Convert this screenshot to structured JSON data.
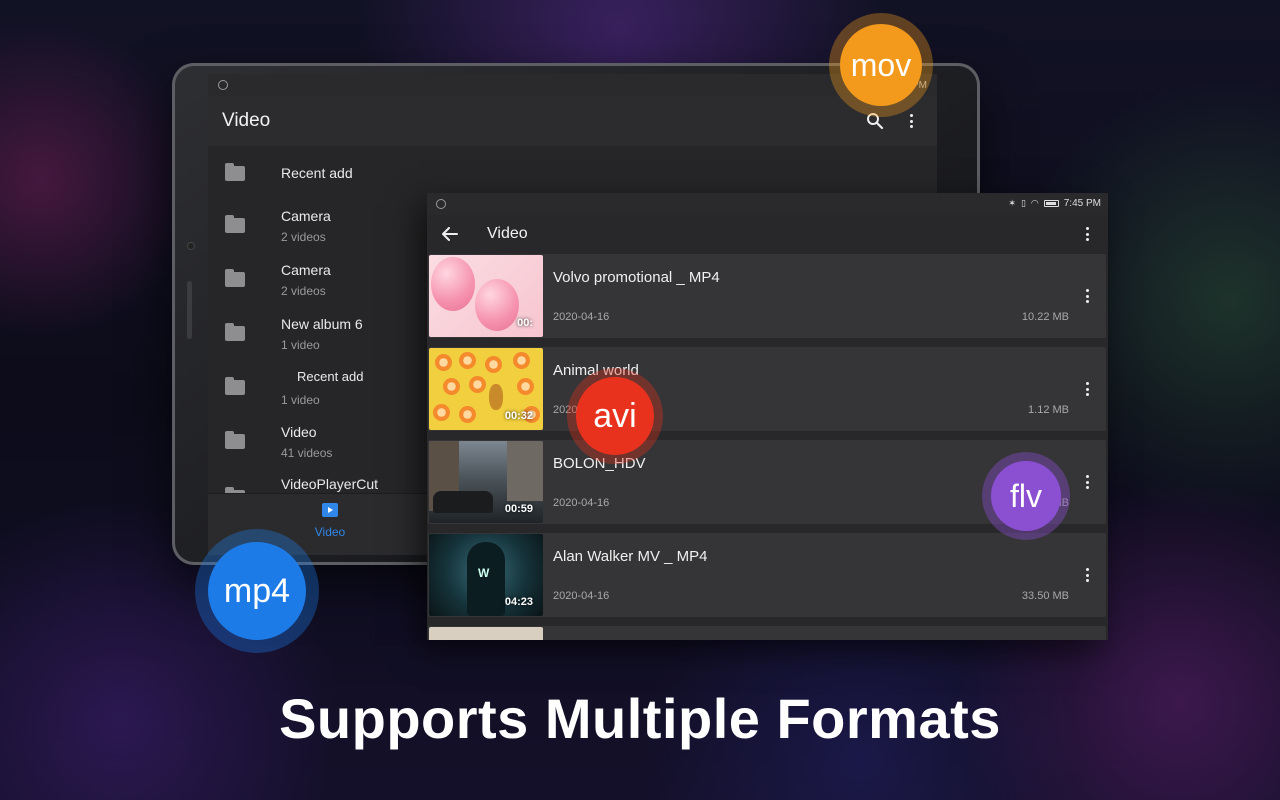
{
  "back_app": {
    "title": "Video",
    "status_time": "PM",
    "folders": [
      {
        "name": "Recent add",
        "count": ""
      },
      {
        "name": "Camera",
        "count": "2  videos"
      },
      {
        "name": "Camera",
        "count": "2  videos"
      },
      {
        "name": "New album 6",
        "count": "1  video"
      },
      {
        "name": "Recent add",
        "count": "1  video"
      },
      {
        "name": "Video",
        "count": "41  videos"
      },
      {
        "name": "VideoPlayerCut",
        "count": ""
      }
    ],
    "nav_label": "Video"
  },
  "front_app": {
    "status_time": "7:45 PM",
    "title": "Video",
    "videos": [
      {
        "title": "Volvo promotional _ MP4",
        "date": "2020-04-16",
        "size": "10.22 MB",
        "duration": "00:"
      },
      {
        "title": "Animal world",
        "date": "2020",
        "size": "1.12 MB",
        "duration": "00:32"
      },
      {
        "title": "BOLON_HDV",
        "date": "2020-04-16",
        "size": "MB",
        "duration": "00:59"
      },
      {
        "title": "Alan Walker MV _ MP4",
        "date": "2020-04-16",
        "size": "33.50 MB",
        "duration": "04:23"
      }
    ]
  },
  "badges": {
    "mov": {
      "label": "mov",
      "color": "#f39a1c"
    },
    "avi": {
      "label": "avi",
      "color": "#e8321e"
    },
    "flv": {
      "label": "flv",
      "color": "#8b4fd1"
    },
    "mp4": {
      "label": "mp4",
      "color": "#1d7be8"
    }
  },
  "headline": "Supports Multiple Formats"
}
